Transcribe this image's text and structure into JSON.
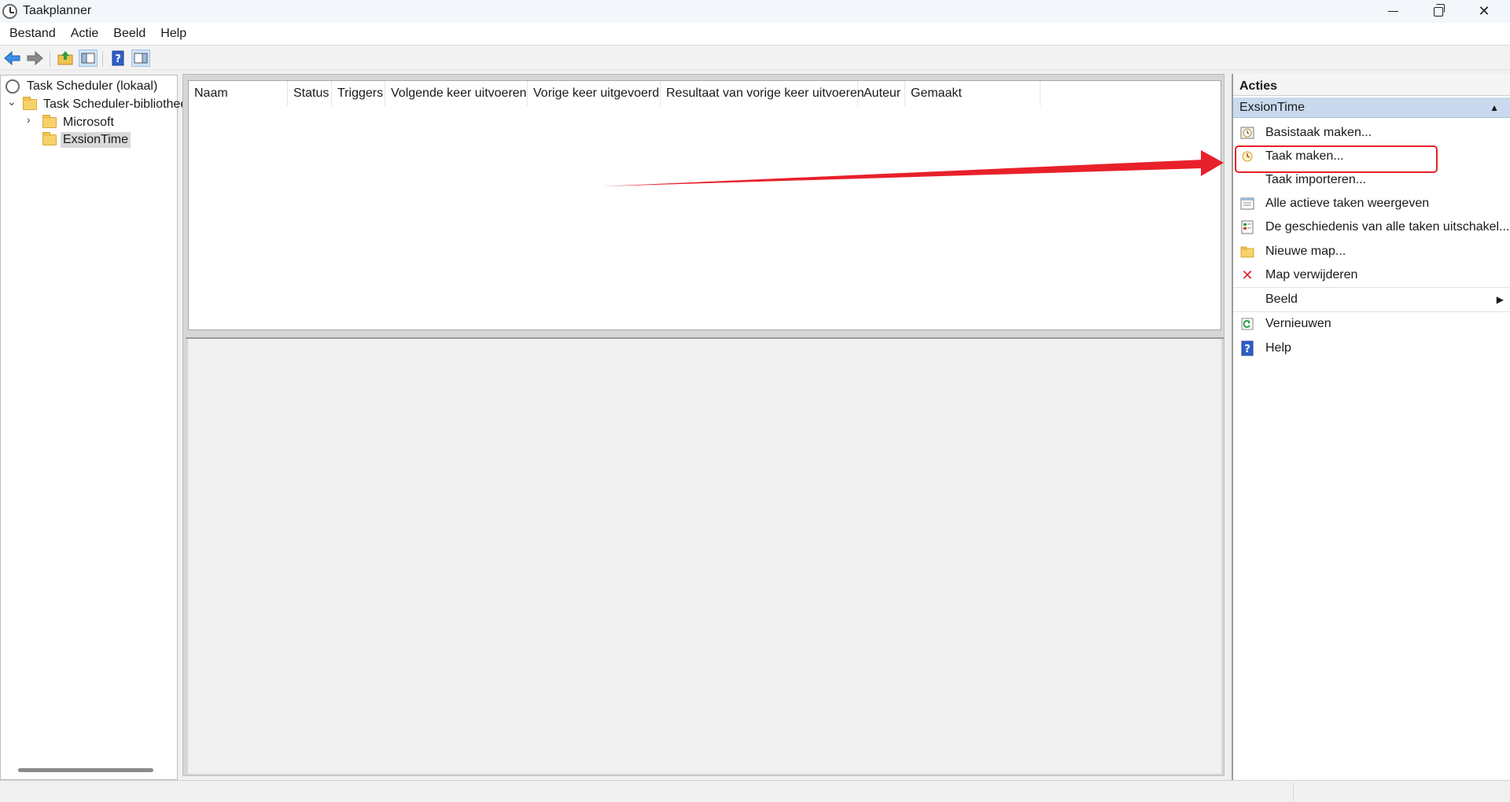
{
  "window": {
    "title": "Taakplanner"
  },
  "menu": [
    "Bestand",
    "Actie",
    "Beeld",
    "Help"
  ],
  "tree": {
    "root": "Task Scheduler (lokaal)",
    "library": "Task Scheduler-bibliotheek",
    "children": [
      "Microsoft",
      "ExsionTime"
    ],
    "selected": "ExsionTime"
  },
  "list_columns": [
    "Naam",
    "Status",
    "Triggers",
    "Volgende keer uitvoeren",
    "Vorige keer uitgevoerd",
    "Resultaat van vorige keer uitvoeren",
    "Auteur",
    "Gemaakt"
  ],
  "actions": {
    "header": "Acties",
    "section": "ExsionTime",
    "items": [
      {
        "label": "Basistaak maken...",
        "icon": "basic-task-icon"
      },
      {
        "label": "Taak maken...",
        "icon": "create-task-icon"
      },
      {
        "label": "Taak importeren...",
        "icon": ""
      },
      {
        "label": "Alle actieve taken weergeven",
        "icon": "active-tasks-icon"
      },
      {
        "label": "De geschiedenis van alle taken uitschakel...",
        "icon": "history-icon"
      },
      {
        "label": "Nieuwe map...",
        "icon": "new-folder-icon"
      },
      {
        "label": "Map verwijderen",
        "icon": "delete-icon"
      },
      {
        "label": "Beeld",
        "icon": ""
      },
      {
        "label": "Vernieuwen",
        "icon": "refresh-icon"
      },
      {
        "label": "Help",
        "icon": "help-icon"
      }
    ]
  },
  "colors": {
    "accent_selection": "#c9daee",
    "annotation": "#e8202a"
  }
}
